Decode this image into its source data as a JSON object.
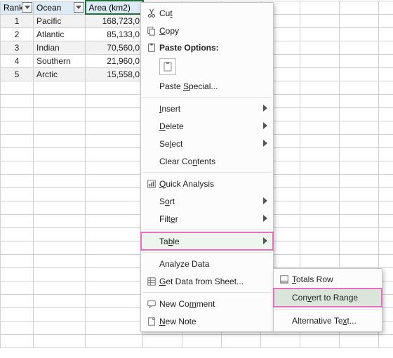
{
  "table": {
    "headers": [
      "Rank",
      "Ocean",
      "Area (km2)"
    ],
    "rows": [
      {
        "rank": "1",
        "ocean": "Pacific",
        "area": "168,723,0"
      },
      {
        "rank": "2",
        "ocean": "Atlantic",
        "area": "85,133,0"
      },
      {
        "rank": "3",
        "ocean": "Indian",
        "area": "70,560,0"
      },
      {
        "rank": "4",
        "ocean": "Southern",
        "area": "21,960,0"
      },
      {
        "rank": "5",
        "ocean": "Arctic",
        "area": "15,558,0"
      }
    ]
  },
  "menu": {
    "cut": "Cut",
    "copy": "Copy",
    "paste_options": "Paste Options:",
    "paste_special": "Paste Special...",
    "insert": "Insert",
    "delete": "Delete",
    "select": "Select",
    "clear_contents": "Clear Contents",
    "quick_analysis": "Quick Analysis",
    "sort": "Sort",
    "filter": "Filter",
    "table": "Table",
    "analyze_data": "Analyze Data",
    "get_data": "Get Data from Sheet...",
    "new_comment": "New Comment",
    "new_note": "New Note"
  },
  "submenu": {
    "totals_row": "Totals Row",
    "convert_to_range": "Convert to Range",
    "alternative_text": "Alternative Text..."
  }
}
